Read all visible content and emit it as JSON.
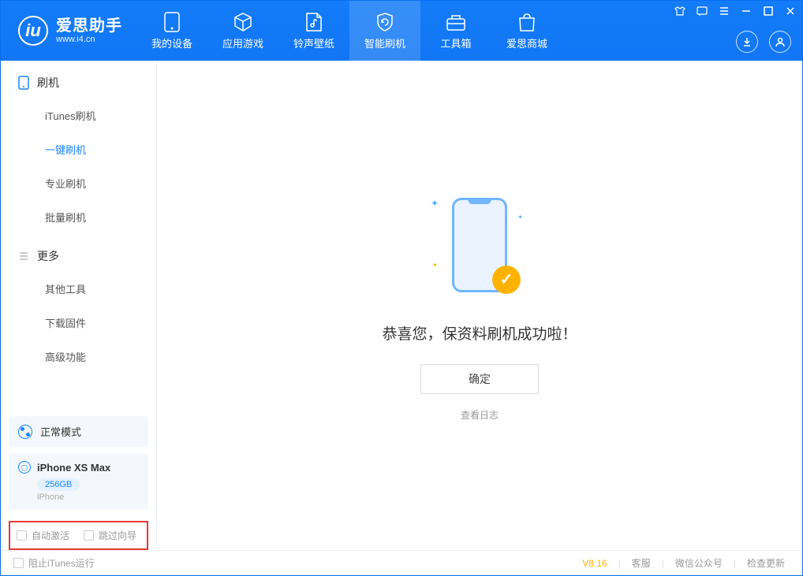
{
  "app": {
    "title": "爱思助手",
    "url": "www.i4.cn"
  },
  "nav": {
    "tabs": [
      {
        "label": "我的设备"
      },
      {
        "label": "应用游戏"
      },
      {
        "label": "铃声壁纸"
      },
      {
        "label": "智能刷机"
      },
      {
        "label": "工具箱"
      },
      {
        "label": "爱思商城"
      }
    ]
  },
  "sidebar": {
    "section1_title": "刷机",
    "items1": [
      {
        "label": "iTunes刷机"
      },
      {
        "label": "一键刷机"
      },
      {
        "label": "专业刷机"
      },
      {
        "label": "批量刷机"
      }
    ],
    "section2_title": "更多",
    "items2": [
      {
        "label": "其他工具"
      },
      {
        "label": "下载固件"
      },
      {
        "label": "高级功能"
      }
    ],
    "mode_label": "正常模式",
    "device": {
      "name": "iPhone XS Max",
      "storage": "256GB",
      "type": "iPhone"
    },
    "highlight": {
      "auto_activate": "自动激活",
      "skip_guide": "跳过向导"
    }
  },
  "main": {
    "success_message": "恭喜您，保资料刷机成功啦！",
    "confirm_label": "确定",
    "log_link": "查看日志"
  },
  "footer": {
    "block_itunes": "阻止iTunes运行",
    "version": "V8.16",
    "links": [
      "客服",
      "微信公众号",
      "检查更新"
    ]
  }
}
